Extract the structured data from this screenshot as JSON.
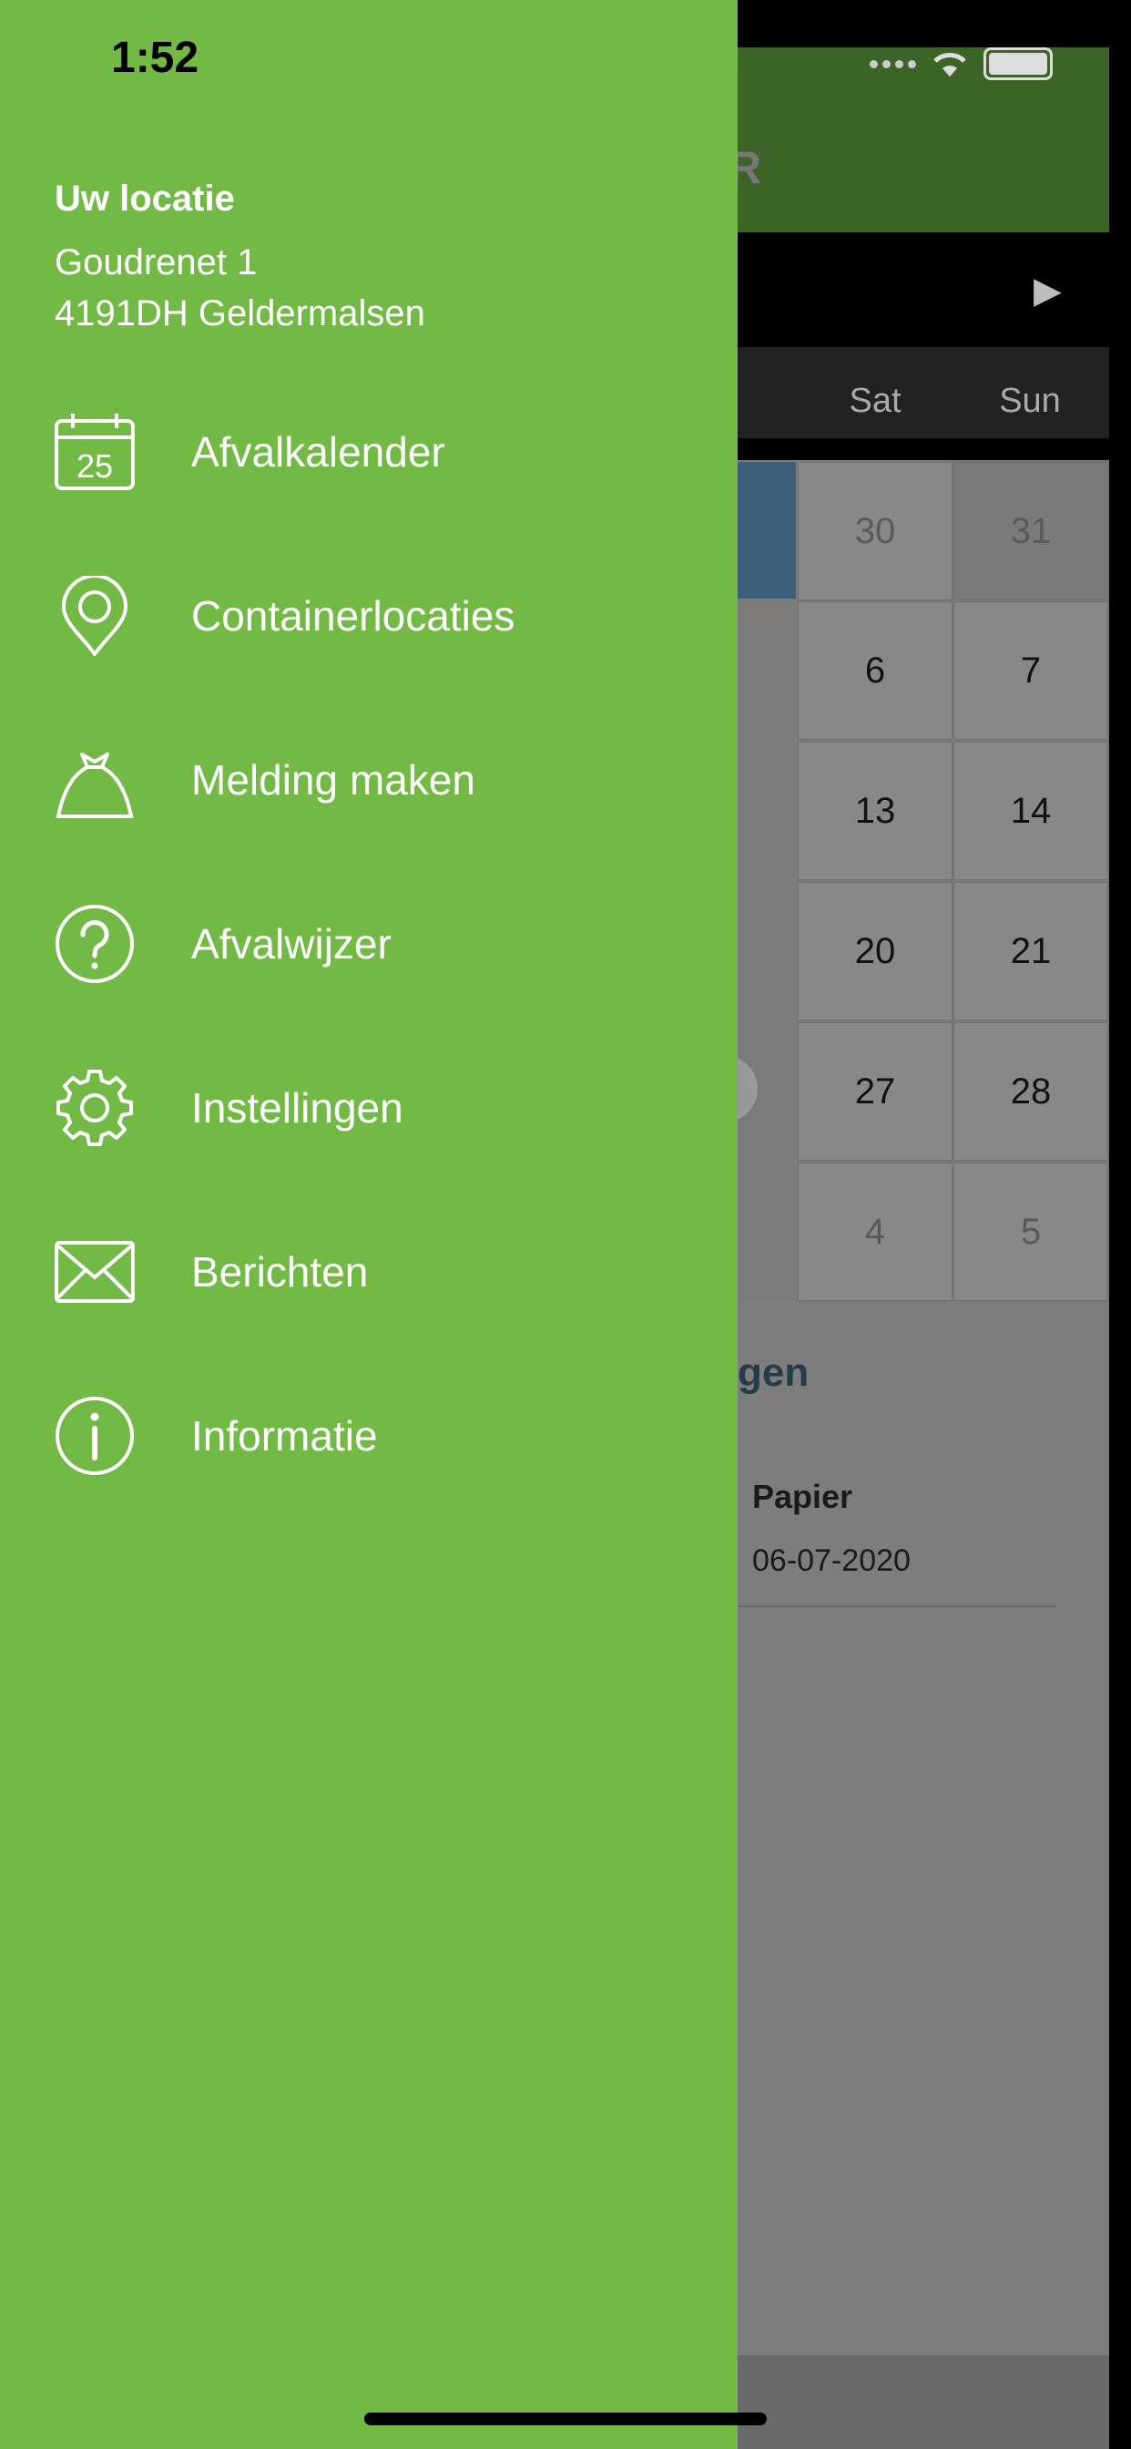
{
  "status_bar": {
    "time": "1:52"
  },
  "background": {
    "header_partial_title": "R",
    "next_month_glyph": "▶",
    "day_headers": [
      "Sat",
      "Sun"
    ],
    "weeks": [
      [
        "30",
        "31"
      ],
      [
        "6",
        "7"
      ],
      [
        "13",
        "14"
      ],
      [
        "20",
        "21"
      ],
      [
        "27",
        "28"
      ],
      [
        "4",
        "5"
      ]
    ],
    "section_title_partial": "gen",
    "item_title": "Papier",
    "item_date": "06-07-2020"
  },
  "drawer": {
    "location_title": "Uw locatie",
    "address_line1": "Goudrenet 1",
    "address_line2": "4191DH Geldermalsen",
    "calendar_icon_day": "25",
    "menu": [
      {
        "label": "Afvalkalender",
        "icon": "calendar-icon"
      },
      {
        "label": "Containerlocaties",
        "icon": "location-pin-icon"
      },
      {
        "label": "Melding maken",
        "icon": "garbage-bag-icon"
      },
      {
        "label": "Afvalwijzer",
        "icon": "help-icon"
      },
      {
        "label": "Instellingen",
        "icon": "gear-icon"
      },
      {
        "label": "Berichten",
        "icon": "mail-icon"
      },
      {
        "label": "Informatie",
        "icon": "info-icon"
      }
    ]
  },
  "colors": {
    "drawer_bg": "#72b946",
    "header_bg": "#3c6426"
  }
}
